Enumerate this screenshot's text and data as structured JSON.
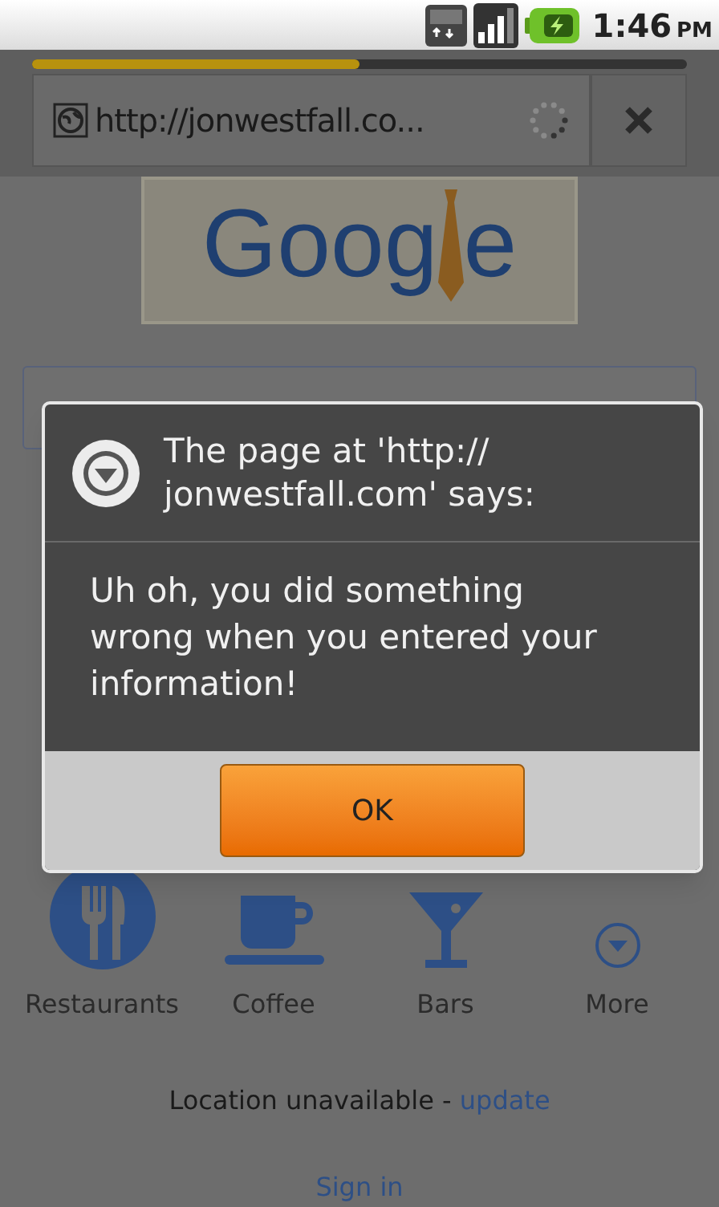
{
  "status_bar": {
    "time": "1:46",
    "time_suffix": "PM"
  },
  "browser": {
    "progress": {
      "level": 0.5
    },
    "url": "http://jonwestfall.co...",
    "loading": true
  },
  "page": {
    "logo_left": "Goog",
    "logo_right": "e",
    "categories": [
      {
        "kind": "restaurant",
        "label": "Restaurants"
      },
      {
        "kind": "coffee",
        "label": "Coffee"
      },
      {
        "kind": "bar",
        "label": "Bars"
      },
      {
        "kind": "more",
        "label": "More"
      }
    ],
    "location": {
      "text": "Location unavailable - ",
      "link": "update"
    },
    "sign_in": "Sign in"
  },
  "dialog": {
    "title": "The page at 'http:// jonwestfall.com' says:",
    "message": "Uh oh, you did something wrong when you entered your information!",
    "button": "OK"
  }
}
